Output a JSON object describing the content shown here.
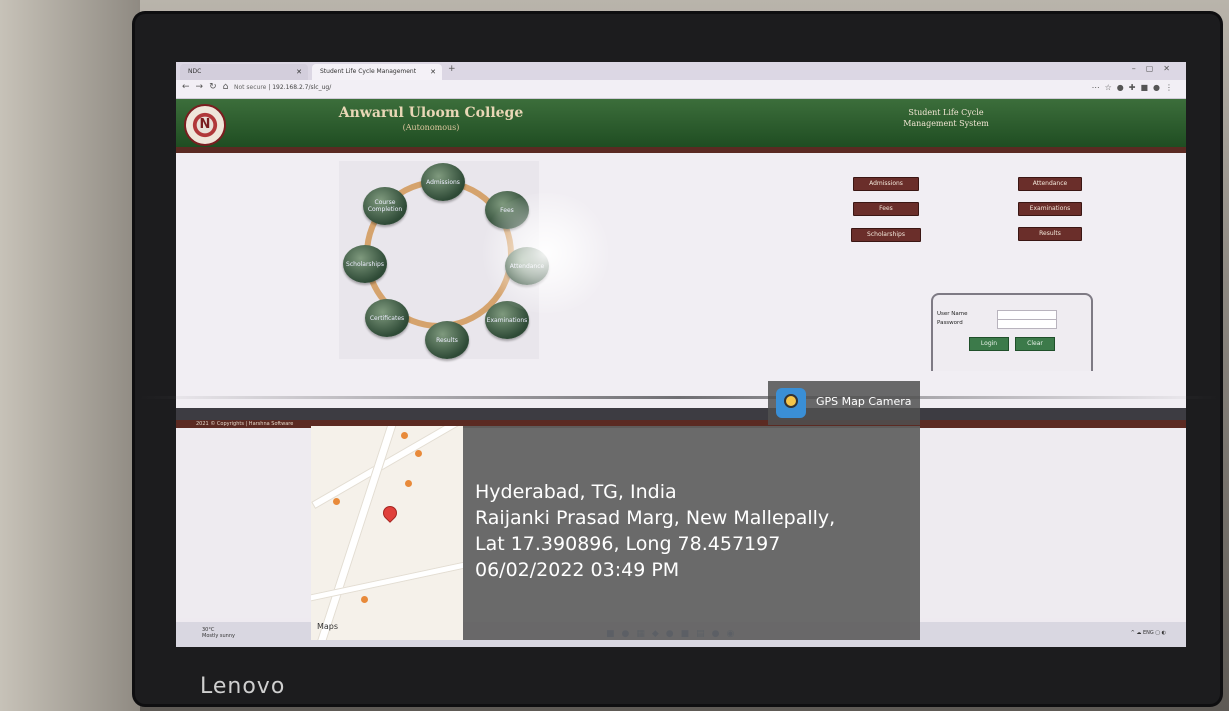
{
  "browser": {
    "tab1_label": "NDC",
    "tab2_label": "Student Life Cycle Management",
    "url_security": "Not secure",
    "url": "192.168.2.7/slc_ug/"
  },
  "header": {
    "college_name": "Anwarul Uloom College",
    "college_sub": "(Autonomous)",
    "system_title_line1": "Student Life Cycle",
    "system_title_line2": "Management System"
  },
  "cycle": {
    "nodes": [
      "Admissions",
      "Fees",
      "Attendance",
      "Examinations",
      "Results",
      "Certificates",
      "Scholarships",
      "Course Completion"
    ]
  },
  "quicklinks": {
    "left": [
      "Admissions",
      "Fees",
      "Scholarships"
    ],
    "right": [
      "Attendance",
      "Examinations",
      "Results"
    ]
  },
  "login": {
    "username_label": "User Name",
    "password_label": "Password",
    "login_button": "Login",
    "clear_button": "Clear"
  },
  "footer": {
    "copyright": "2021 © Copyrights | Harshna Software"
  },
  "taskbar": {
    "temp": "30°C",
    "weather": "Mostly sunny"
  },
  "gps": {
    "badge_label": "GPS Map Camera",
    "map_brand": "Maps",
    "line1": "Hyderabad, TG, India",
    "line2": "Raijanki Prasad Marg, New Mallepally,",
    "line3": "Lat 17.390896, Long 78.457197",
    "line4": "06/02/2022 03:49 PM"
  },
  "monitor_brand": "Lenovo"
}
